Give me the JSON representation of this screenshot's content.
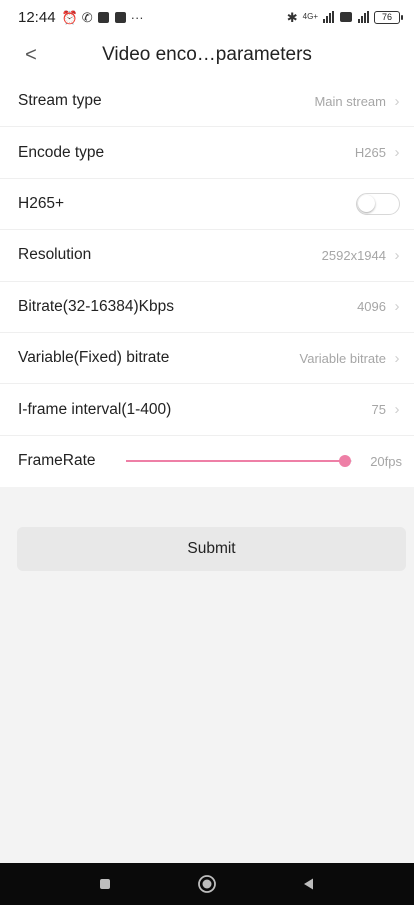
{
  "status_bar": {
    "time": "12:44",
    "network": "4G+",
    "battery": "76"
  },
  "header": {
    "title": "Video enco…parameters",
    "back_glyph": "<"
  },
  "settings": [
    {
      "label": "Stream type",
      "value": "Main stream"
    },
    {
      "label": "Encode type",
      "value": "H265"
    },
    {
      "label": "H265+",
      "toggle_on": false
    },
    {
      "label": "Resolution",
      "value": "2592x1944"
    },
    {
      "label": "Bitrate(32-16384)Kbps",
      "value": "4096"
    },
    {
      "label": "Variable(Fixed) bitrate",
      "value": "Variable bitrate"
    },
    {
      "label": "I-frame interval(1-400)",
      "value": "75"
    }
  ],
  "framerate": {
    "label": "FrameRate",
    "value_text": "20fps",
    "level": 0.97
  },
  "submit_label": "Submit",
  "colors": {
    "accent": "#ee7fa6",
    "value_text": "#a6a6a6",
    "nav_bar": "#0a0a0a"
  },
  "icons": {
    "back": "chevron-left-icon",
    "row": "chevron-right-icon",
    "nav": [
      "recents-square-icon",
      "home-circle-icon",
      "back-triangle-icon"
    ]
  }
}
